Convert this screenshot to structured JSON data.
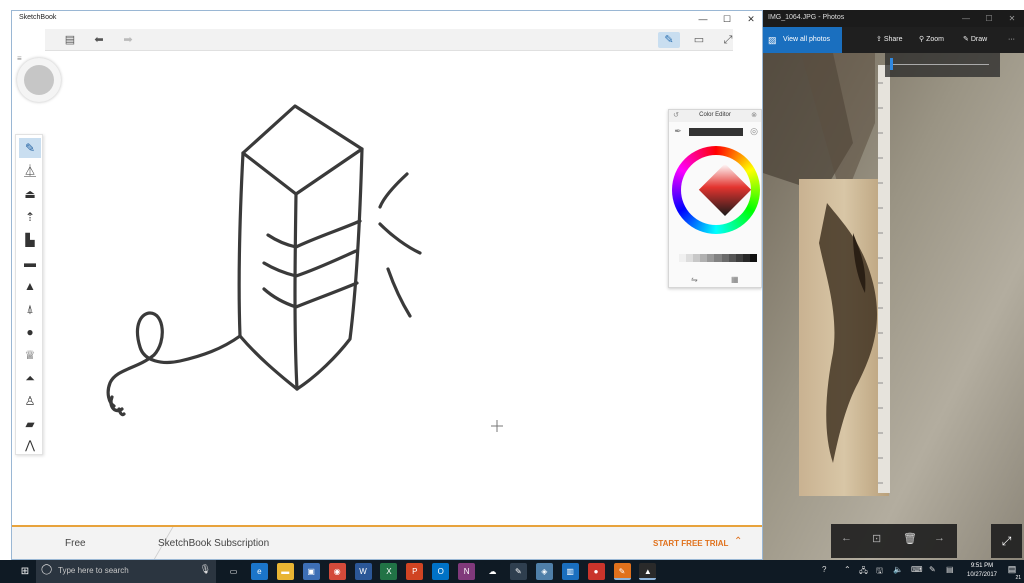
{
  "sketchbook": {
    "title": "SketchBook",
    "window_controls": [
      "—",
      "☐",
      "✕"
    ],
    "toolbar": {
      "left_icons": [
        "gallery-icon",
        "undo-icon",
        "redo-icon"
      ],
      "right_icons": [
        "pencil-tool-icon",
        "canvas-view-icon",
        "fullscreen-icon"
      ]
    },
    "brushes": [
      "pencil",
      "technical-pen",
      "felt-pen",
      "fine-brush",
      "marker",
      "flat-marker",
      "ballpoint-pen",
      "paint-brush",
      "ink-brush",
      "soft-airbrush",
      "hard-airbrush",
      "chisel-marker",
      "eraser",
      "smear-brush"
    ],
    "color_editor": {
      "title": "Color Editor",
      "current_color": "#333333",
      "grayscale_swatches": [
        "#f0f0f0",
        "#dddddd",
        "#c8c8c8",
        "#b0b0b0",
        "#999999",
        "#828282",
        "#6b6b6b",
        "#555555",
        "#3e3e3e",
        "#282828",
        "#111111"
      ]
    },
    "footer": {
      "free_label": "Free",
      "subscription_label": "SketchBook Subscription",
      "trial_button": "START FREE TRIAL",
      "chevron": "⌃"
    }
  },
  "photos": {
    "title": "IMG_1064.JPG - Photos",
    "window_controls": [
      "—",
      "☐",
      "✕"
    ],
    "view_all_label": "View all photos",
    "share_label": "Share",
    "zoom_label": "Zoom",
    "draw_label": "Draw",
    "more_label": "···",
    "zoom_slider_value": 0.0,
    "nav": [
      "←",
      "⊡",
      "🗑",
      "→"
    ],
    "fullscreen_glyph": "⤢"
  },
  "taskbar": {
    "search_placeholder": "Type here to search",
    "apps": [
      {
        "name": "task-view",
        "glyph": "▭",
        "color": "#0f1a24"
      },
      {
        "name": "edge",
        "glyph": "e",
        "color": "#1b75c9"
      },
      {
        "name": "file-explorer",
        "glyph": "▬",
        "color": "#e9b533"
      },
      {
        "name": "store",
        "glyph": "▣",
        "color": "#3d6fb5"
      },
      {
        "name": "chrome",
        "glyph": "◉",
        "color": "#d34a3a"
      },
      {
        "name": "word",
        "glyph": "W",
        "color": "#2b5797"
      },
      {
        "name": "excel",
        "glyph": "X",
        "color": "#217346"
      },
      {
        "name": "powerpoint",
        "glyph": "P",
        "color": "#d04423"
      },
      {
        "name": "outlook",
        "glyph": "O",
        "color": "#0072c6"
      },
      {
        "name": "onenote",
        "glyph": "N",
        "color": "#80397b"
      },
      {
        "name": "onedrive",
        "glyph": "☁",
        "color": "#0f1a24"
      },
      {
        "name": "sketchbook-pen",
        "glyph": "✎",
        "color": "#2f3f4f"
      },
      {
        "name": "mixed-reality",
        "glyph": "◈",
        "color": "#4f7fa8"
      },
      {
        "name": "photos-app",
        "glyph": "▥",
        "color": "#1a6fbf"
      },
      {
        "name": "red-app",
        "glyph": "●",
        "color": "#c9342b"
      },
      {
        "name": "sketchbook",
        "glyph": "✎",
        "color": "#e0711c"
      },
      {
        "name": "photos",
        "glyph": "▲",
        "color": "#2a2a2a"
      }
    ],
    "tray_icons": [
      "?",
      "⌃",
      "🖧",
      "🖫",
      "🔈",
      "⌨",
      "✎",
      "▤"
    ],
    "time": "9:51 PM",
    "date": "10/27/2017",
    "notification_count": "21"
  }
}
